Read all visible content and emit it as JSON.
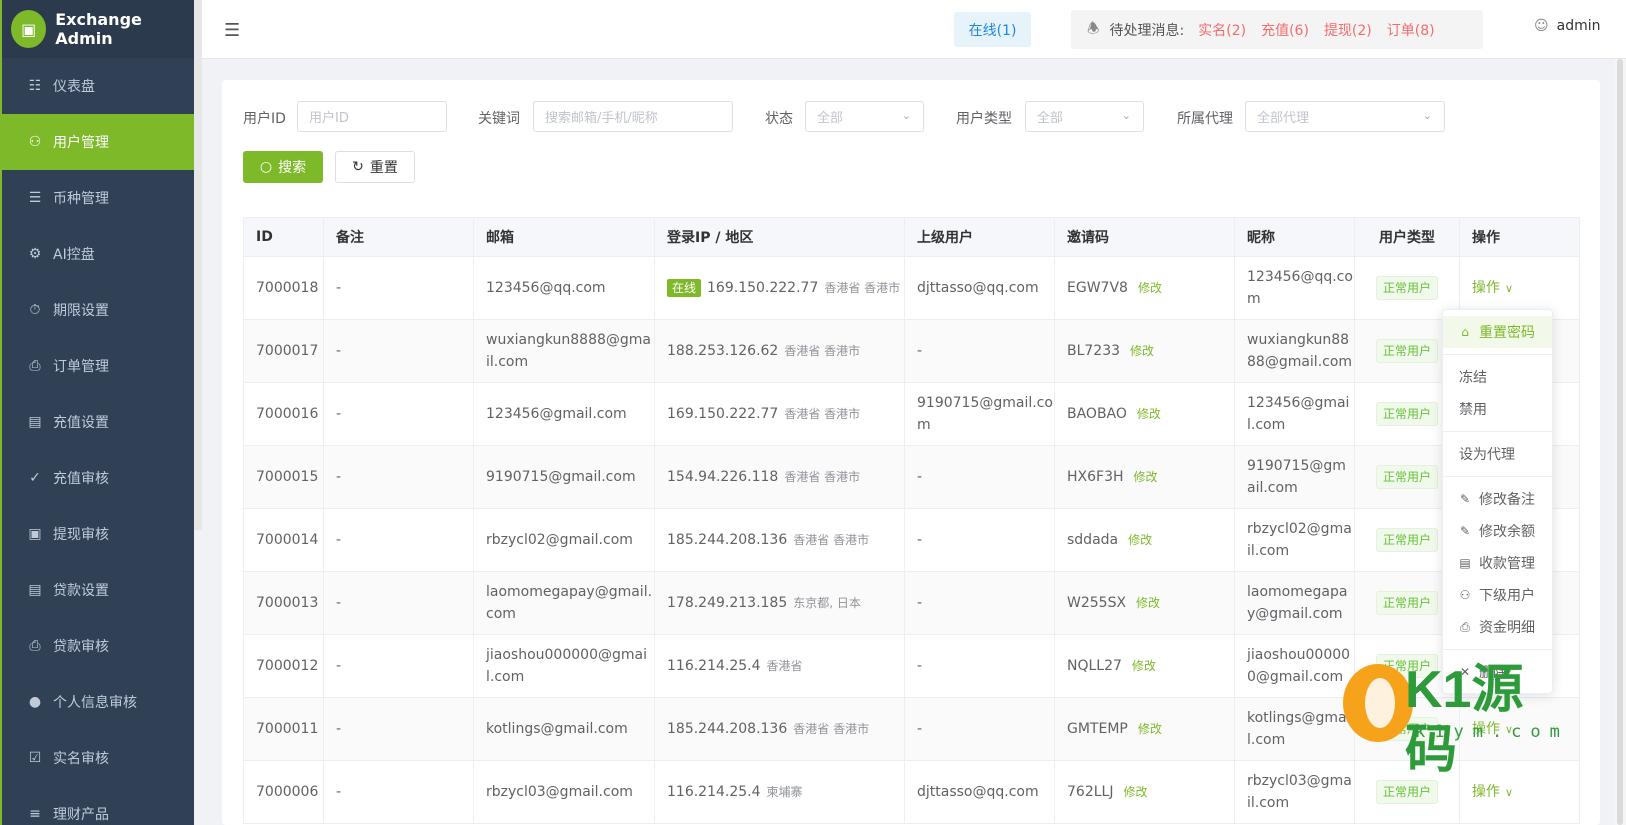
{
  "app": {
    "title": "Exchange Admin"
  },
  "sidebar": {
    "items": [
      {
        "label": "仪表盘",
        "icon": "chart-icon"
      },
      {
        "label": "用户管理",
        "icon": "user-icon",
        "active": true
      },
      {
        "label": "币种管理",
        "icon": "database-icon"
      },
      {
        "label": "AI控盘",
        "icon": "gear-icon"
      },
      {
        "label": "期限设置",
        "icon": "timer-icon"
      },
      {
        "label": "订单管理",
        "icon": "document-icon"
      },
      {
        "label": "充值设置",
        "icon": "folder-icon"
      },
      {
        "label": "充值审核",
        "icon": "check-icon"
      },
      {
        "label": "提现审核",
        "icon": "picture-icon"
      },
      {
        "label": "贷款设置",
        "icon": "folder-icon"
      },
      {
        "label": "贷款审核",
        "icon": "document-icon"
      },
      {
        "label": "个人信息审核",
        "icon": "person-filled-icon"
      },
      {
        "label": "实名审核",
        "icon": "document-check-icon"
      },
      {
        "label": "理财产品",
        "icon": "coins-icon"
      }
    ]
  },
  "header": {
    "online_label": "在线(1)",
    "pending_label": "待处理消息:",
    "pending_items": [
      "实名(2)",
      "充值(6)",
      "提现(2)",
      "订单(8)"
    ],
    "user": "admin"
  },
  "filters": {
    "user_id_label": "用户ID",
    "user_id_placeholder": "用户ID",
    "keyword_label": "关键词",
    "keyword_placeholder": "搜索邮箱/手机/昵称",
    "status_label": "状态",
    "status_value": "全部",
    "user_type_label": "用户类型",
    "user_type_value": "全部",
    "agent_label": "所属代理",
    "agent_value": "全部代理",
    "search_button": "搜索",
    "reset_button": "重置"
  },
  "table": {
    "columns": [
      "ID",
      "备注",
      "邮箱",
      "登录IP / 地区",
      "上级用户",
      "邀请码",
      "昵称",
      "用户类型",
      "操作"
    ],
    "edit_label": "修改",
    "op_label": "操作",
    "online_tag": "在线",
    "rows": [
      {
        "id": "7000018",
        "note": "-",
        "email": "123456@qq.com",
        "online": true,
        "ip": "169.150.222.77",
        "region": "香港省 香港市",
        "parent": "djttasso@qq.com",
        "code": "EGW7V8",
        "nickname": "123456@qq.com",
        "type": "正常用户",
        "show_op": true
      },
      {
        "id": "7000017",
        "note": "-",
        "email": "wuxiangkun8888@gmail.com",
        "online": false,
        "ip": "188.253.126.62",
        "region": "香港省 香港市",
        "parent": "-",
        "code": "BL7233",
        "nickname": "wuxiangkun8888@gmail.com",
        "type": "正常用户",
        "show_op": false
      },
      {
        "id": "7000016",
        "note": "-",
        "email": "123456@gmail.com",
        "online": false,
        "ip": "169.150.222.77",
        "region": "香港省 香港市",
        "parent": "9190715@gmail.com",
        "code": "BAOBAO",
        "nickname": "123456@gmail.com",
        "type": "正常用户",
        "show_op": false
      },
      {
        "id": "7000015",
        "note": "-",
        "email": "9190715@gmail.com",
        "online": false,
        "ip": "154.94.226.118",
        "region": "香港省 香港市",
        "parent": "-",
        "code": "HX6F3H",
        "nickname": "9190715@gmail.com",
        "type": "正常用户",
        "show_op": false
      },
      {
        "id": "7000014",
        "note": "-",
        "email": "rbzycl02@gmail.com",
        "online": false,
        "ip": "185.244.208.136",
        "region": "香港省 香港市",
        "parent": "-",
        "code": "sddada",
        "nickname": "rbzycl02@gmail.com",
        "type": "正常用户",
        "show_op": false
      },
      {
        "id": "7000013",
        "note": "-",
        "email": "laomomegapay@gmail.com",
        "online": false,
        "ip": "178.249.213.185",
        "region": "东京都, 日本",
        "parent": "-",
        "code": "W255SX",
        "nickname": "laomomegapay@gmail.com",
        "type": "正常用户",
        "show_op": false
      },
      {
        "id": "7000012",
        "note": "-",
        "email": "jiaoshou000000@gmail.com",
        "online": false,
        "ip": "116.214.25.4",
        "region": "香港省",
        "parent": "-",
        "code": "NQLL27",
        "nickname": "jiaoshou000000@gmail.com",
        "type": "正常用户",
        "show_op": false
      },
      {
        "id": "7000011",
        "note": "-",
        "email": "kotlings@gmail.com",
        "online": false,
        "ip": "185.244.208.136",
        "region": "香港省 香港市",
        "parent": "-",
        "code": "GMTEMP",
        "nickname": "kotlings@gmail.com",
        "type": "正常用户",
        "show_op": true
      },
      {
        "id": "7000006",
        "note": "-",
        "email": "rbzycl03@gmail.com",
        "online": false,
        "ip": "116.214.25.4",
        "region": "柬埔寨",
        "parent": "djttasso@qq.com",
        "code": "762LLJ",
        "nickname": "rbzycl03@gmail.com",
        "type": "正常用户",
        "show_op": true
      }
    ]
  },
  "dropdown": {
    "items": [
      {
        "label": "重置密码",
        "icon": "lock-icon",
        "hl": true
      },
      {
        "divider": true
      },
      {
        "label": "冻结",
        "icon": ""
      },
      {
        "label": "禁用",
        "icon": ""
      },
      {
        "divider": true
      },
      {
        "label": "设为代理",
        "icon": ""
      },
      {
        "divider": true
      },
      {
        "label": "修改备注",
        "icon": "edit-icon"
      },
      {
        "label": "修改余额",
        "icon": "edit-icon"
      },
      {
        "label": "收款管理",
        "icon": "folder-icon"
      },
      {
        "label": "下级用户",
        "icon": "user-icon"
      },
      {
        "label": "资金明细",
        "icon": "document-icon"
      },
      {
        "divider": true
      },
      {
        "label": "删除",
        "icon": "trash-icon"
      }
    ]
  },
  "watermark": {
    "text": "K1源码",
    "sub": "k1ym.com"
  }
}
